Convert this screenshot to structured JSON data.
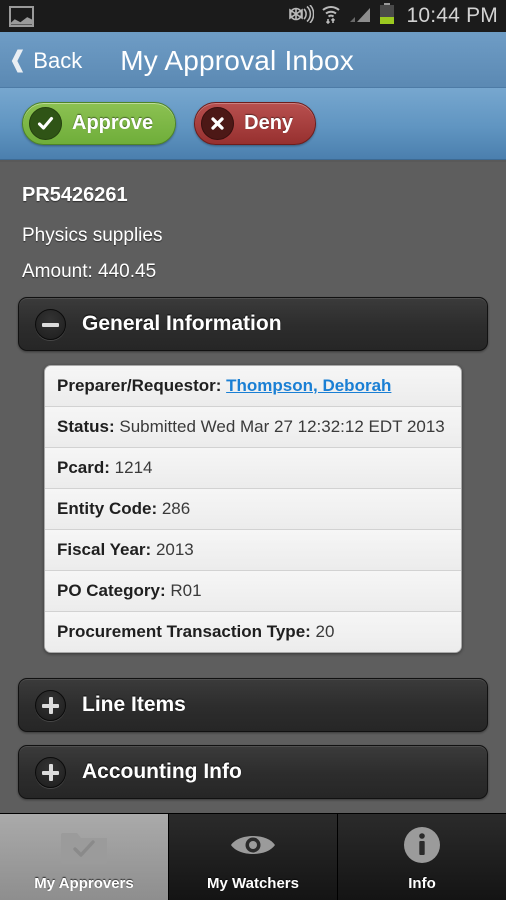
{
  "statusbar": {
    "notification_icon": "photo-icon",
    "icons": [
      "cast-icon",
      "wifi-icon",
      "signal-icon",
      "battery-icon"
    ],
    "time": "10:44 PM"
  },
  "titlebar": {
    "back_label": "Back",
    "back_icon": "chevron-left-icon",
    "title": "My Approval Inbox"
  },
  "actionbar": {
    "approve_label": "Approve",
    "approve_icon": "check-circle-icon",
    "deny_label": "Deny",
    "deny_icon": "x-circle-icon"
  },
  "record": {
    "id": "PR5426261",
    "description": "Physics supplies",
    "amount": "Amount: 440.45"
  },
  "sections": [
    {
      "title": "General Information",
      "expanded": true,
      "toggle_icon": "minus-circle-icon",
      "rows": [
        {
          "label": "Preparer/Requestor:",
          "value": "Thompson, Deborah",
          "is_link": true
        },
        {
          "label": "Status:",
          "value": "Submitted Wed Mar 27 12:32:12 EDT 2013",
          "is_link": false
        },
        {
          "label": "Pcard:",
          "value": "1214",
          "is_link": false
        },
        {
          "label": "Entity Code:",
          "value": "286",
          "is_link": false
        },
        {
          "label": "Fiscal Year:",
          "value": "2013",
          "is_link": false
        },
        {
          "label": "PO Category:",
          "value": "R01",
          "is_link": false
        },
        {
          "label": "Procurement Transaction Type:",
          "value": "20",
          "is_link": false
        }
      ]
    },
    {
      "title": "Line Items",
      "expanded": false,
      "toggle_icon": "plus-circle-icon",
      "rows": []
    },
    {
      "title": "Accounting Info",
      "expanded": false,
      "toggle_icon": "plus-circle-icon",
      "rows": []
    }
  ],
  "tabbar": {
    "tabs": [
      {
        "label": "My Approvers",
        "icon": "folder-check-icon",
        "active": true
      },
      {
        "label": "My Watchers",
        "icon": "eye-icon",
        "active": false
      },
      {
        "label": "Info",
        "icon": "info-circle-icon",
        "active": false
      }
    ]
  },
  "colors": {
    "title_bar": "#5b89b3",
    "action_bar": "#6095c1",
    "body": "#5e5e5e",
    "accordion": "#2d2d2d",
    "approve_green": "#7bb546",
    "deny_red": "#a43b3a",
    "link_blue": "#1a7fd4",
    "active_tab": "#9a9a9a"
  }
}
